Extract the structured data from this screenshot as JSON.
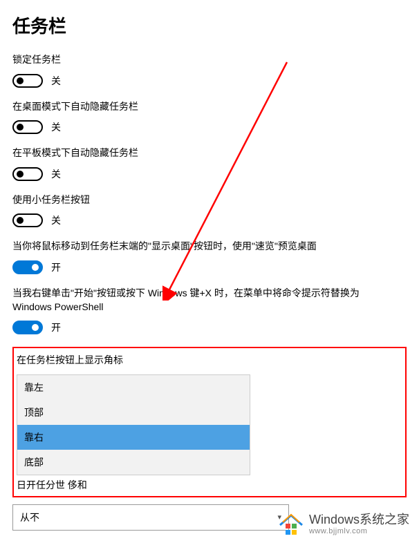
{
  "page": {
    "title": "任务栏"
  },
  "settings": {
    "lock": {
      "label": "锁定任务栏",
      "state": "关",
      "on": false
    },
    "autohide_desktop": {
      "label": "在桌面模式下自动隐藏任务栏",
      "state": "关",
      "on": false
    },
    "autohide_tablet": {
      "label": "在平板模式下自动隐藏任务栏",
      "state": "关",
      "on": false
    },
    "small_buttons": {
      "label": "使用小任务栏按钮",
      "state": "关",
      "on": false
    },
    "peek": {
      "label": "当你将鼠标移动到任务栏末端的\"显示桌面\"按钮时，使用\"速览\"预览桌面",
      "state": "开",
      "on": true
    },
    "powershell": {
      "label": "当我右键单击\"开始\"按钮或按下 Windows 键+X 时，在菜单中将命令提示符替换为 Windows PowerShell",
      "state": "开",
      "on": true
    },
    "badges": {
      "label": "在任务栏按钮上显示角标",
      "options": [
        "靠左",
        "顶部",
        "靠右",
        "底部"
      ],
      "selected_index": 2
    },
    "partial_hidden": "日开任分世 侈和",
    "combine": {
      "value": "从不"
    }
  },
  "watermark": {
    "main": "Windows系统之家",
    "sub": "www.bjjmlv.com"
  }
}
